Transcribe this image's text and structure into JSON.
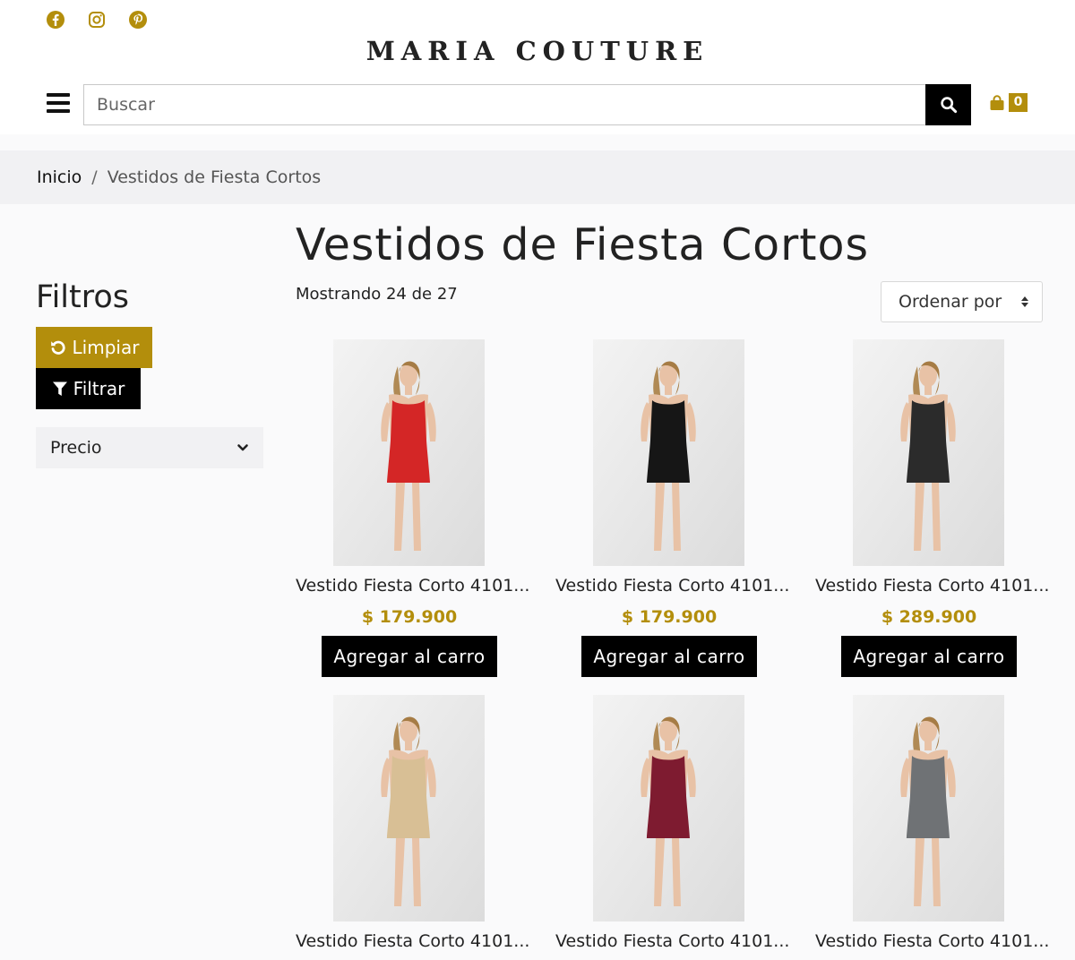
{
  "brand": {
    "logo_text": "MARIA COUTURE",
    "accent_color": "#b38e0c"
  },
  "social": [
    {
      "icon": "facebook-icon"
    },
    {
      "icon": "instagram-icon"
    },
    {
      "icon": "pinterest-icon"
    }
  ],
  "header": {
    "search_placeholder": "Buscar",
    "cart_count": "0"
  },
  "breadcrumb": {
    "home": "Inicio",
    "separator": "/",
    "current": "Vestidos de Fiesta Cortos"
  },
  "sidebar": {
    "title": "Filtros",
    "clear_label": "Limpiar",
    "filter_label": "Filtrar",
    "price_label": "Precio"
  },
  "main": {
    "title": "Vestidos de Fiesta Cortos",
    "results_text": "Mostrando 24 de 27",
    "sort_label": "Ordenar por"
  },
  "products": [
    {
      "name": "Vestido Fiesta Corto 4101...",
      "price": "$ 179.900",
      "button": "Agregar al carro",
      "dress_color": "#d42626"
    },
    {
      "name": "Vestido Fiesta Corto 4101...",
      "price": "$ 179.900",
      "button": "Agregar al carro",
      "dress_color": "#161616"
    },
    {
      "name": "Vestido Fiesta Corto 4101...",
      "price": "$ 289.900",
      "button": "Agregar al carro",
      "dress_color": "#2b2b2b"
    },
    {
      "name": "Vestido Fiesta Corto 4101...",
      "price": "",
      "button": "",
      "dress_color": "#d8bf95"
    },
    {
      "name": "Vestido Fiesta Corto 4101...",
      "price": "",
      "button": "",
      "dress_color": "#7e1b30"
    },
    {
      "name": "Vestido Fiesta Corto 4101...",
      "price": "",
      "button": "",
      "dress_color": "#6f7275"
    }
  ]
}
